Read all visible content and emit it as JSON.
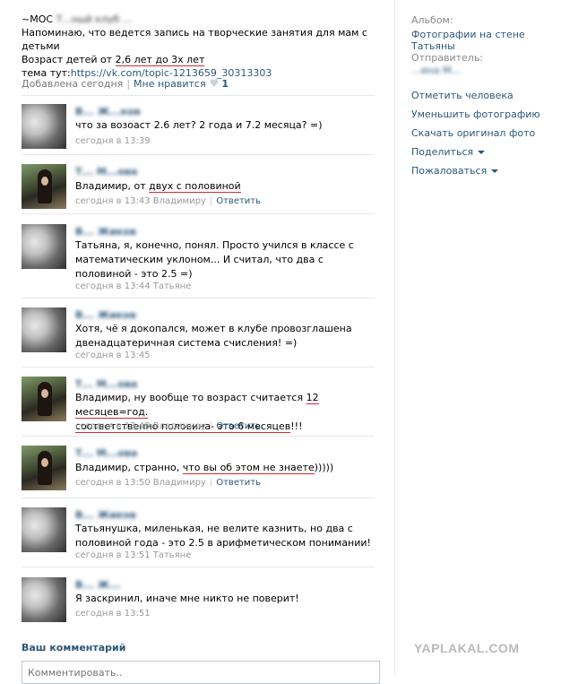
{
  "post": {
    "line1_prefix": "~МОС",
    "line1_redacted": "Т...ный клуб ...",
    "line2": "Напоминаю, что ведется запись на творческие занятия для мам с детьми",
    "line3_prefix": "Возраст детей от ",
    "line3_underlined": "2,6 лет до 3х лет",
    "line4_prefix": "тема тут:",
    "line4_link": "https://vk.com/topic-1213659_30313303",
    "added": "Добавлена сегодня",
    "like_label": "Мне нравится",
    "like_count": "1"
  },
  "comments": [
    {
      "author": "В... Ж...ков",
      "text": "что за возоаст 2.6 лет? 2 года и 7.2 месяца? =)",
      "time": "сегодня в 13:39",
      "reply_to": "",
      "reply_label": "",
      "avatar": "b"
    },
    {
      "author": "Т... М...ова",
      "text_before": "Владимир, от ",
      "text_underlined": "двух с половиной",
      "time": "сегодня в 13:43",
      "reply_to": "Владимиру",
      "reply_label": "Ответить",
      "avatar": "t"
    },
    {
      "author": "В... Жиков",
      "text": "Татьяна, я, конечно, понял. Просто учился в классе с математическим уклоном... И считал, что два с половиной - это 2.5 =)",
      "time": "сегодня в 13:44",
      "reply_to": "Татьяне",
      "reply_label": "",
      "avatar": "b"
    },
    {
      "author": "В... Жиков",
      "text": "Хотя, чё я докопался, может в клубе провозглашена двенадцатеричная система счисления! =)",
      "time": "сегодня в 13:45",
      "reply_to": "",
      "reply_label": "",
      "avatar": "b"
    },
    {
      "author": "Т... М...ова",
      "text_before": "Владимир, ну вообще то возраст считается ",
      "text_underlined": "12 месяцев=год.",
      "text_line2_underlined": "соответственно половина- это 6 месяцев",
      "text_after": "!!!",
      "time": "сегодня в 13:49",
      "reply_to": "Владимиру",
      "reply_label": "Ответить",
      "avatar": "t"
    },
    {
      "author": "Т... М...ова",
      "text_before": "Владимир, странно, ",
      "text_underlined": "что вы об этом не знаете",
      "text_after": ")))))",
      "time": "сегодня в 13:50",
      "reply_to": "Владимиру",
      "reply_label": "Ответить",
      "avatar": "t"
    },
    {
      "author": "В... Жиков",
      "text": "Татьянушка, миленькая, не велите казнить, но два с половиной года - это 2.5 в арифметическом понимании!",
      "time": "сегодня в 13:51",
      "reply_to": "Татьяне",
      "reply_label": "",
      "avatar": "b"
    },
    {
      "author": "В... Ж...",
      "text": "Я заскринил, иначе мне никто не поверит!",
      "time": "сегодня в 13:51",
      "reply_to": "",
      "reply_label": "",
      "avatar": "b"
    }
  ],
  "comment_box": {
    "title": "Ваш комментарий",
    "placeholder": "Комментировать.."
  },
  "watermark": "YAPLAKAL.COM",
  "sidebar": {
    "album_label": "Альбом:",
    "album_link": "Фотографии на стене Татьяны",
    "sender_label": "Отправитель:",
    "sender_name": "...ина М...",
    "actions": [
      "Отметить человека",
      "Уменьшить фотографию",
      "Скачать оригинал фото"
    ],
    "share": "Поделиться",
    "report": "Пожаловаться"
  },
  "colors": {
    "link": "#2b587a",
    "underline": "#d32b2b",
    "muted": "#999999"
  }
}
